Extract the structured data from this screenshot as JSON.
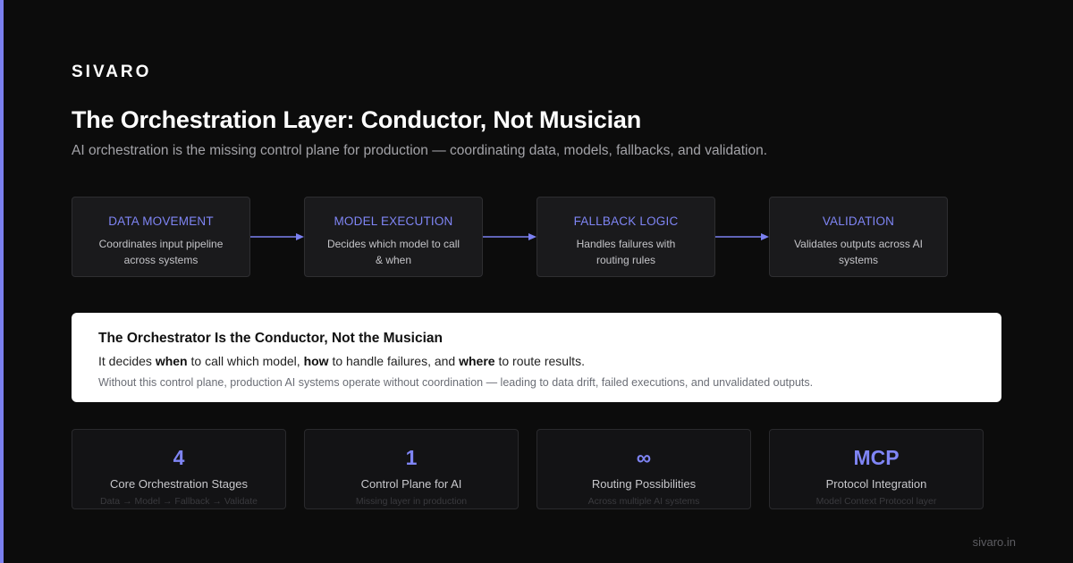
{
  "brand": "SIVARO",
  "title": "The Orchestration Layer: Conductor, Not Musician",
  "subtitle": "AI orchestration is the missing control plane for production — coordinating data, models, fallbacks, and validation.",
  "pipeline": [
    {
      "title": "DATA MOVEMENT",
      "description": "Coordinates input pipeline across systems"
    },
    {
      "title": "MODEL EXECUTION",
      "description": "Decides which model to call & when"
    },
    {
      "title": "FALLBACK LOGIC",
      "description": "Handles failures with routing rules"
    },
    {
      "title": "VALIDATION",
      "description": "Validates outputs across AI systems"
    }
  ],
  "callout": {
    "title": "The Orchestrator Is the Conductor, Not the Musician",
    "line_prefix": "It decides ",
    "emph_1": "when",
    "line_mid_1": " to call which model, ",
    "emph_2": "how",
    "line_mid_2": " to handle failures, and ",
    "emph_3": "where",
    "line_suffix": " to route results.",
    "note": "Without this control plane, production AI systems operate without coordination — leading to data drift, failed executions, and unvalidated outputs."
  },
  "stats": [
    {
      "value": "4",
      "label": "Core Orchestration Stages",
      "sub": "Data → Model → Fallback → Validate"
    },
    {
      "value": "1",
      "label": "Control Plane for AI",
      "sub": "Missing layer in production"
    },
    {
      "value": "∞",
      "label": "Routing Possibilities",
      "sub": "Across multiple AI systems"
    },
    {
      "value": "MCP",
      "label": "Protocol Integration",
      "sub": "Model Context Protocol layer"
    }
  ],
  "footer": "sivaro.in",
  "colors": {
    "accent": "#7b80f0",
    "background": "#0c0c0c",
    "card": "#1a1a1c"
  }
}
